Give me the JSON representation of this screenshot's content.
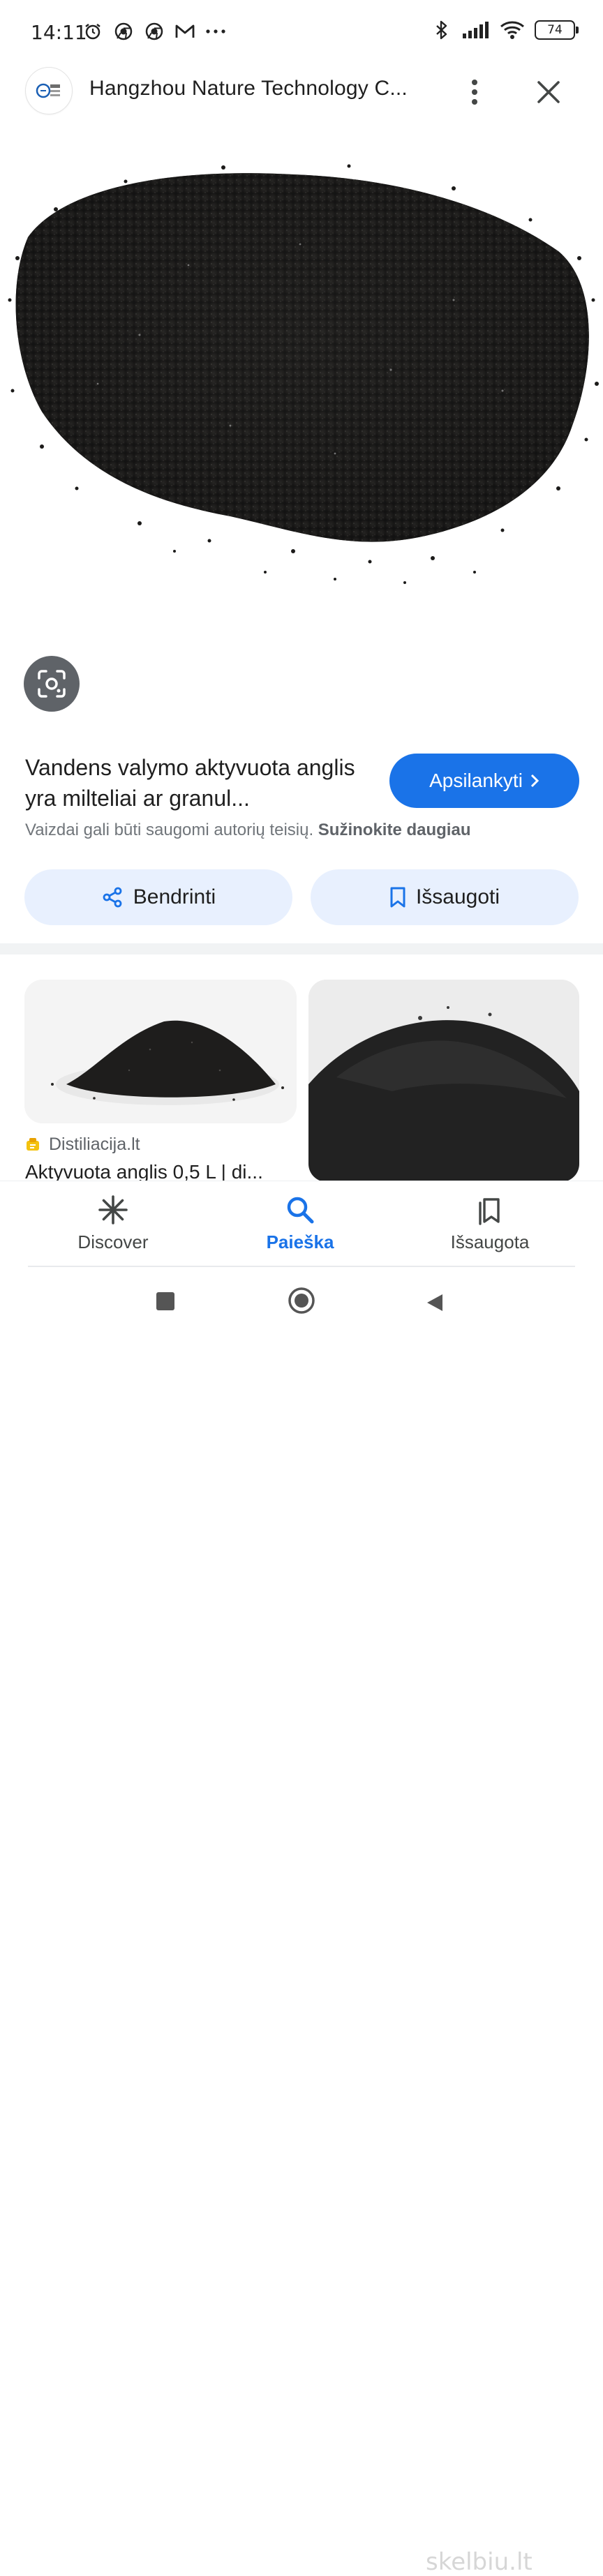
{
  "status_bar": {
    "time": "14:11",
    "battery": "74",
    "left_icons": [
      "alarm-icon",
      "chrome-icon",
      "chrome-icon",
      "gmail-icon",
      "more-dots-icon"
    ],
    "right_icons": [
      "bluetooth-icon",
      "signal-icon",
      "wifi-icon",
      "battery-icon"
    ]
  },
  "header": {
    "site_name": "Hangzhou Nature Technology C..."
  },
  "result": {
    "title": "Vandens valymo aktyvuota anglis yra milteliai ar granul...",
    "visit_label": "Apsilankyti",
    "copyright_text": "Vaizdai gali būti saugomi autorių teisių.",
    "learn_more_label": "Sužinokite daugiau"
  },
  "actions": {
    "share_label": "Bendrinti",
    "save_label": "Išsaugoti"
  },
  "related": {
    "source_name": "Distiliacija.lt",
    "title": "Aktyvuota anglis 0,5 L | di..."
  },
  "bottom_nav": {
    "discover": "Discover",
    "search": "Paieška",
    "saved": "Išsaugota"
  },
  "watermark": "skelbiu.lt",
  "colors": {
    "accent": "#1a73e8",
    "chip_bg": "#e8f0fe",
    "lens_bg": "#5f6368"
  }
}
